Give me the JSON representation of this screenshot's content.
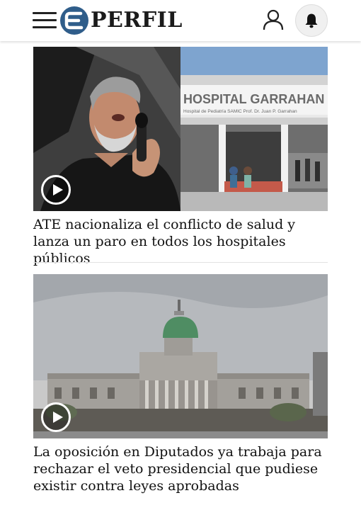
{
  "header": {
    "logo_text": "PERFIL",
    "menu_icon": "hamburger-menu-icon",
    "user_icon": "user-icon",
    "bell_icon": "bell-icon",
    "brand_color": "#2f5d8a"
  },
  "articles": [
    {
      "headline": "ATE nacionaliza el conflicto de salud y lanza un paro en todos los hospitales públicos",
      "image_text_line1": "HOSPITAL GARRAHAN",
      "image_text_line2": "Hospital de Pediatría SAMIC  Prof. Dr. Juan P. Garrahan",
      "media_icon": "play-icon"
    },
    {
      "headline": "La oposición en Diputados ya trabaja para rechazar el veto presidencial que pudiese existir contra leyes aprobadas",
      "media_icon": "play-icon"
    }
  ]
}
